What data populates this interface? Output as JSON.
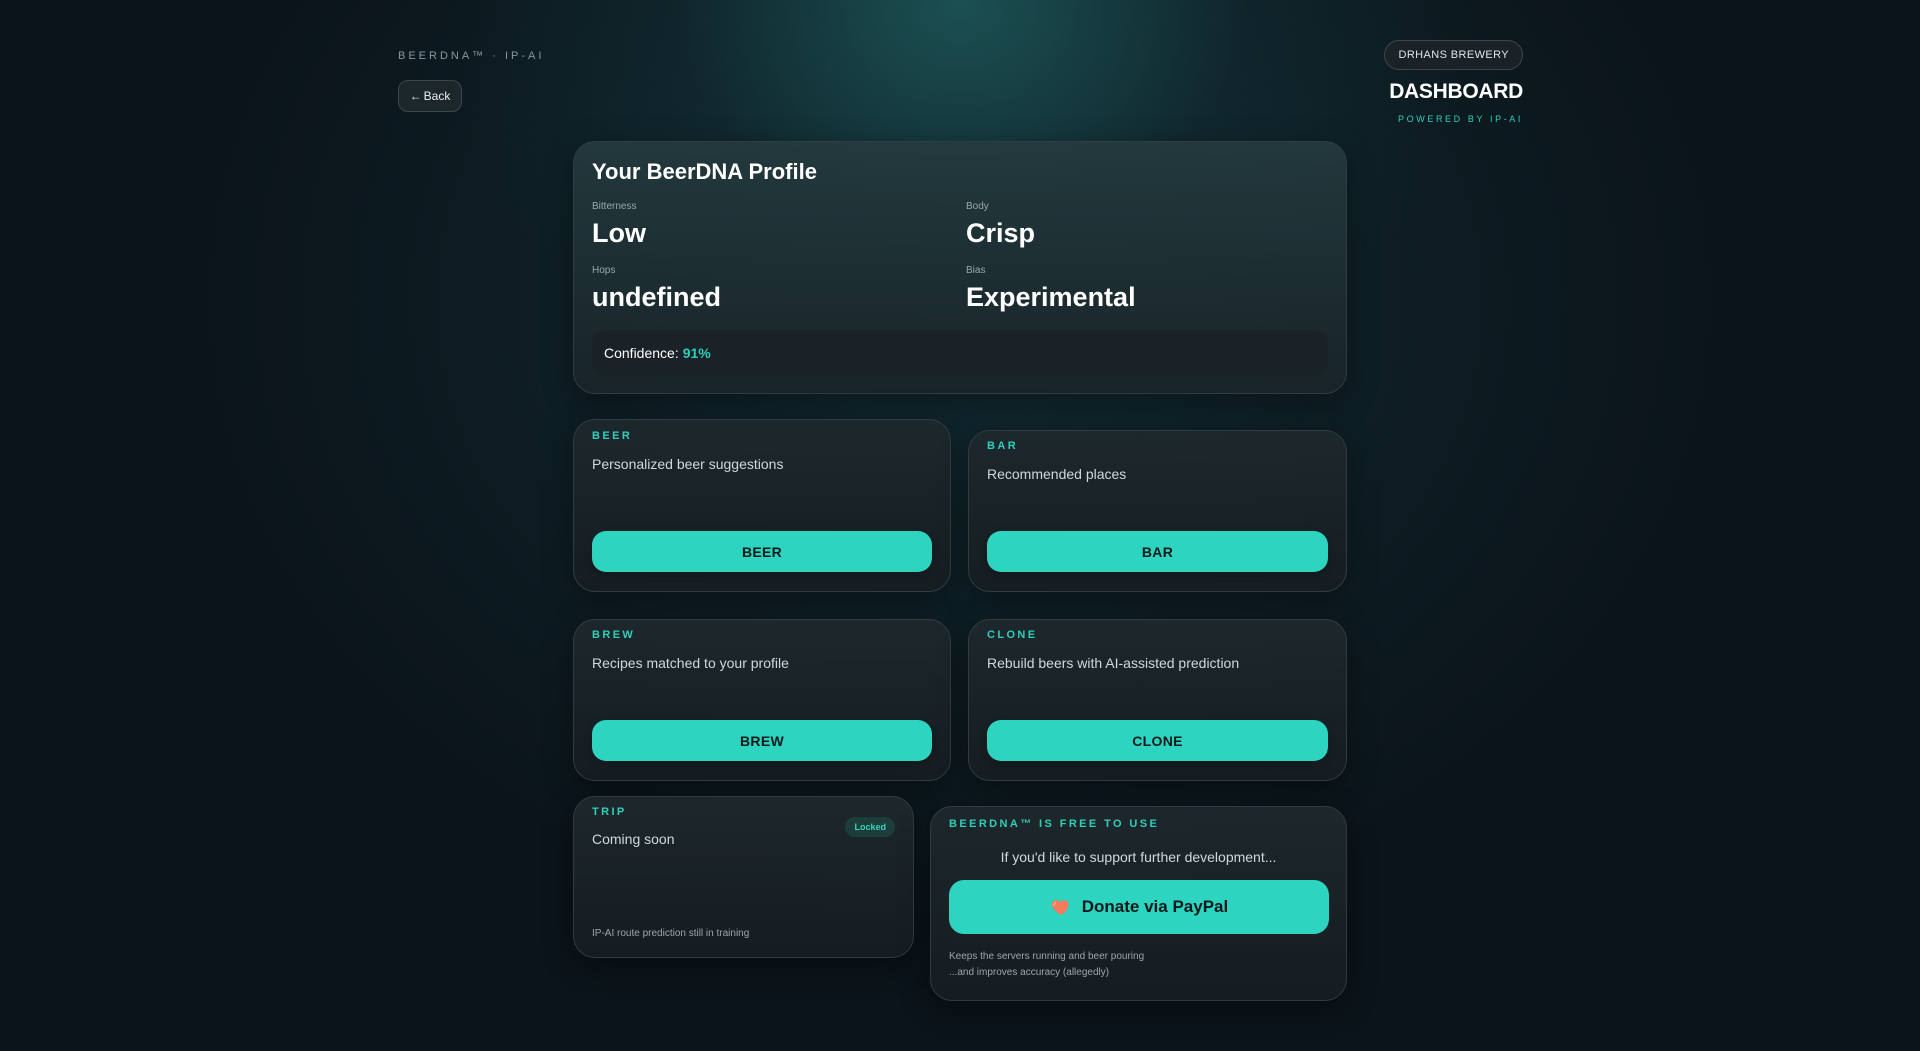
{
  "header": {
    "brand": "BEERDNA™ · IP-AI",
    "back_arrow": "←",
    "back_label": "Back",
    "brewery": "DRHANS BREWERY",
    "title": "DASHBOARD",
    "powered_by": "POWERED BY IP-AI"
  },
  "profile": {
    "title": "Your BeerDNA Profile",
    "traits": [
      {
        "label": "Bitterness",
        "value": "Low"
      },
      {
        "label": "Body",
        "value": "Crisp"
      },
      {
        "label": "Hops",
        "value": "undefined"
      },
      {
        "label": "Bias",
        "value": "Experimental"
      }
    ],
    "confidence_label": "Confidence:",
    "confidence_value": "91%"
  },
  "features": {
    "beer": {
      "tag": "BEER",
      "description": "Personalized beer suggestions",
      "button": "BEER"
    },
    "bar": {
      "tag": "BAR",
      "description": "Recommended places",
      "button": "BAR"
    },
    "brew": {
      "tag": "BREW",
      "description": "Recipes matched to your profile",
      "button": "BREW"
    },
    "clone": {
      "tag": "CLONE",
      "description": "Rebuild beers with AI-assisted prediction",
      "button": "CLONE"
    },
    "trip": {
      "tag": "TRIP",
      "description": "Coming soon",
      "badge": "Locked",
      "note": "IP-AI route prediction still in training"
    }
  },
  "donate": {
    "tag": "BEERDNA™ IS FREE TO USE",
    "intro": "If you'd like to support further development...",
    "button": "Donate via PayPal",
    "icon": "heart-icon",
    "note_line1": "Keeps the servers running and beer pouring",
    "note_line2": "...and improves accuracy (allegedly)"
  },
  "colors": {
    "accent": "#2dd4bf",
    "background": "#0b141a",
    "card": "#1c2429",
    "heart": "#f47c5c"
  }
}
